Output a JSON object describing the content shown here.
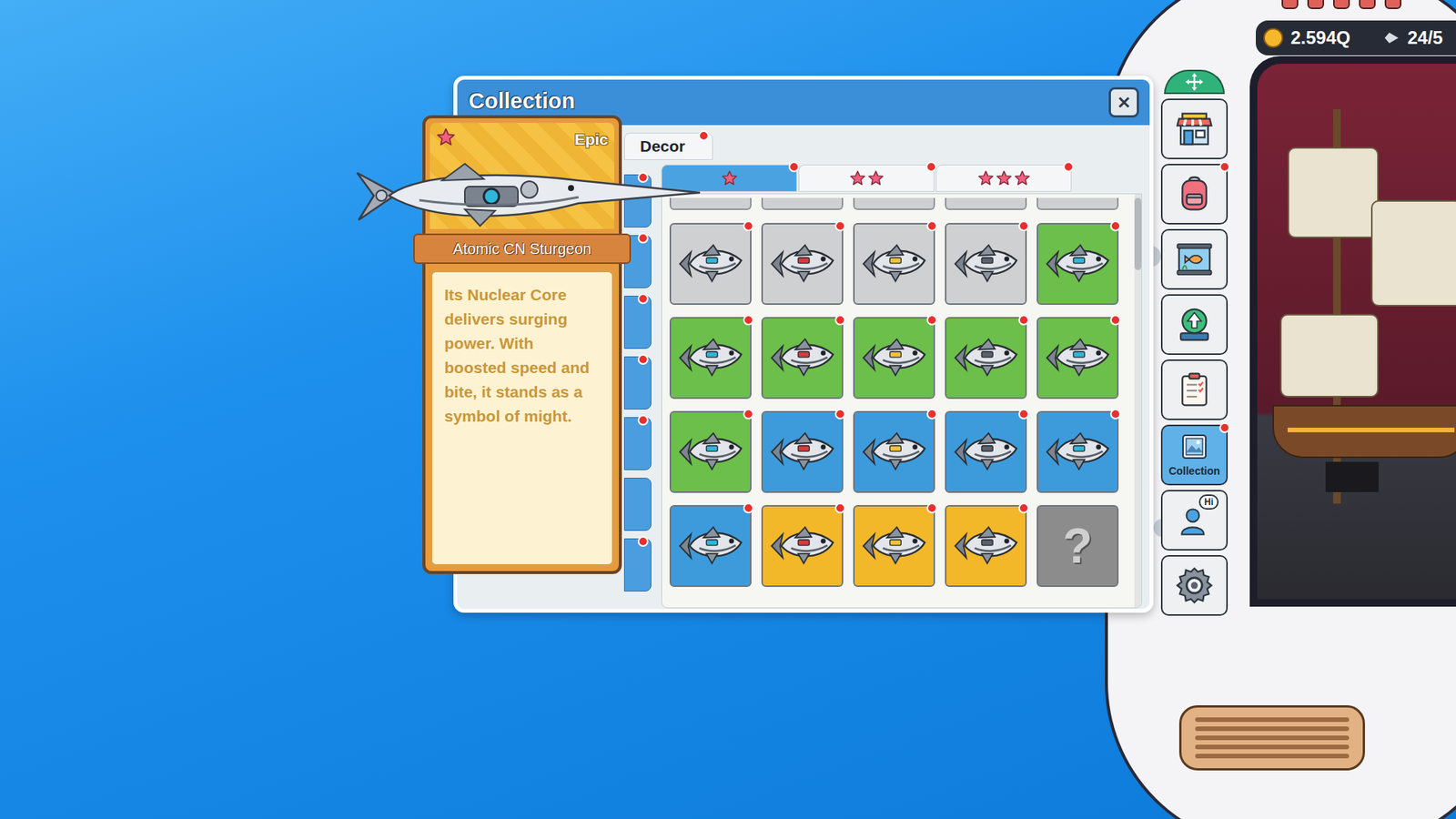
{
  "window": {
    "title": "Collection",
    "close": "✕"
  },
  "category_tabs": [
    {
      "label": "Decor",
      "new": true
    }
  ],
  "side_tabs": [
    {
      "new": true
    },
    {
      "new": true
    },
    {
      "new": true
    },
    {
      "new": true
    },
    {
      "new": true
    },
    {
      "new": false
    },
    {
      "new": true
    }
  ],
  "star_tabs": [
    {
      "stars": 1,
      "selected": true,
      "new": true
    },
    {
      "stars": 2,
      "selected": false,
      "new": true
    },
    {
      "stars": 3,
      "selected": false,
      "new": true
    }
  ],
  "grid": {
    "cells": [
      {
        "kind": "fish",
        "color": "#cfd0d2",
        "new": true
      },
      {
        "kind": "fish",
        "color": "#cfd0d2",
        "new": true
      },
      {
        "kind": "fish",
        "color": "#cfd0d2",
        "new": true
      },
      {
        "kind": "fish",
        "color": "#cfd0d2",
        "new": true
      },
      {
        "kind": "fish",
        "color": "#6cbf4a",
        "new": true
      },
      {
        "kind": "fish",
        "color": "#6cbf4a",
        "new": true
      },
      {
        "kind": "fish",
        "color": "#6cbf4a",
        "new": true
      },
      {
        "kind": "fish",
        "color": "#6cbf4a",
        "new": true
      },
      {
        "kind": "fish",
        "color": "#6cbf4a",
        "new": true
      },
      {
        "kind": "fish",
        "color": "#6cbf4a",
        "new": true
      },
      {
        "kind": "fish",
        "color": "#6cbf4a",
        "new": true
      },
      {
        "kind": "fish",
        "color": "#3d9bdb",
        "new": true
      },
      {
        "kind": "fish",
        "color": "#3d9bdb",
        "new": true
      },
      {
        "kind": "fish",
        "color": "#3d9bdb",
        "new": true
      },
      {
        "kind": "fish",
        "color": "#3d9bdb",
        "new": true
      },
      {
        "kind": "fish",
        "color": "#3d9bdb",
        "new": true
      },
      {
        "kind": "fish",
        "color": "#f2b82a",
        "new": true
      },
      {
        "kind": "fish",
        "color": "#f2b82a",
        "new": true
      },
      {
        "kind": "fish",
        "color": "#f2b82a",
        "new": true
      },
      {
        "kind": "unknown",
        "color": "#8c8c8c",
        "new": false,
        "label": "?"
      }
    ]
  },
  "detail_card": {
    "rarity": "Epic",
    "stars": 1,
    "name": "Atomic CN Sturgeon",
    "description": "Its Nuclear Core delivers surging power. With boosted speed and bite, it stands as a symbol of might."
  },
  "toolbar": [
    {
      "kind": "move",
      "selected": false,
      "new": false
    },
    {
      "kind": "shop",
      "selected": false,
      "new": false
    },
    {
      "kind": "backpack",
      "selected": false,
      "new": true
    },
    {
      "kind": "aquarium",
      "selected": false,
      "new": false
    },
    {
      "kind": "upgrade",
      "selected": false,
      "new": false
    },
    {
      "kind": "quests",
      "selected": false,
      "new": false
    },
    {
      "kind": "collection",
      "selected": true,
      "new": true,
      "label": "Collection"
    },
    {
      "kind": "profile",
      "selected": false,
      "new": false,
      "badge": "Hi"
    },
    {
      "kind": "settings",
      "selected": false,
      "new": false
    }
  ],
  "status": {
    "coins": "2.594Q",
    "capacity": "24/5"
  }
}
